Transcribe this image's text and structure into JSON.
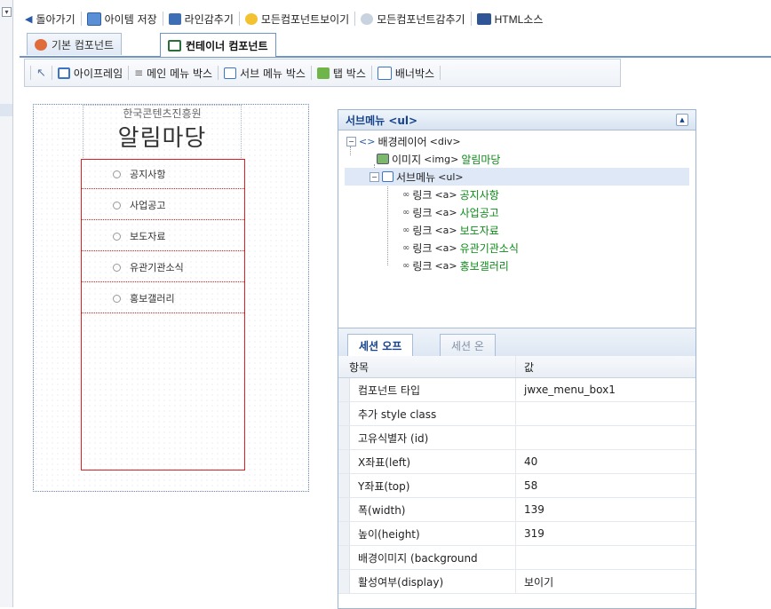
{
  "toolbar": {
    "back": "돌아가기",
    "save_item": "아이템 저장",
    "hide_lines": "라인감추기",
    "show_all": "모든컴포넌트보이기",
    "hide_all": "모든컴포넌트감추기",
    "html_source": "HTML소스"
  },
  "tabs": [
    {
      "label": "기본 컴포넌트"
    },
    {
      "label": "컨테이너 컴포넌트"
    }
  ],
  "container_toolbar": {
    "iframe": "아이프레임",
    "main_menu": "메인 메뉴 박스",
    "sub_menu": "서브 메뉴 박스",
    "tab_box": "탭 박스",
    "banner_box": "배너박스"
  },
  "canvas": {
    "org_name": "한국콘텐츠진흥원",
    "board_title": "알림마당",
    "menu_items": [
      "공지사항",
      "사업공고",
      "보도자료",
      "유관기관소식",
      "홍보갤러리"
    ]
  },
  "panel": {
    "title": "서브메뉴 <ul>",
    "tree": {
      "layer": {
        "label": "배경레이어",
        "tag": "<div>"
      },
      "image": {
        "label": "이미지",
        "tag": "<img>",
        "value": "알림마당"
      },
      "submenu": {
        "label": "서브메뉴",
        "tag": "<ul>"
      },
      "link_label": "링크",
      "link_tag": "<a>",
      "links": [
        "공지사항",
        "사업공고",
        "보도자료",
        "유관기관소식",
        "홍보갤러리"
      ]
    },
    "subtabs": {
      "off_tab": "세션 오프",
      "on_tab": "세션 온"
    },
    "grid_header": {
      "name": "항목",
      "value": "값"
    },
    "properties": [
      {
        "name": "컴포넌트 타입",
        "value": "jwxe_menu_box1"
      },
      {
        "name": "추가 style class",
        "value": ""
      },
      {
        "name": "고유식별자 (id)",
        "value": ""
      },
      {
        "name": "X좌표(left)",
        "value": "40"
      },
      {
        "name": "Y좌표(top)",
        "value": "58"
      },
      {
        "name": "폭(width)",
        "value": "139"
      },
      {
        "name": "높이(height)",
        "value": "319"
      },
      {
        "name": "배경이미지 (background",
        "value": ""
      },
      {
        "name": "활성여부(display)",
        "value": "보이기"
      }
    ]
  }
}
